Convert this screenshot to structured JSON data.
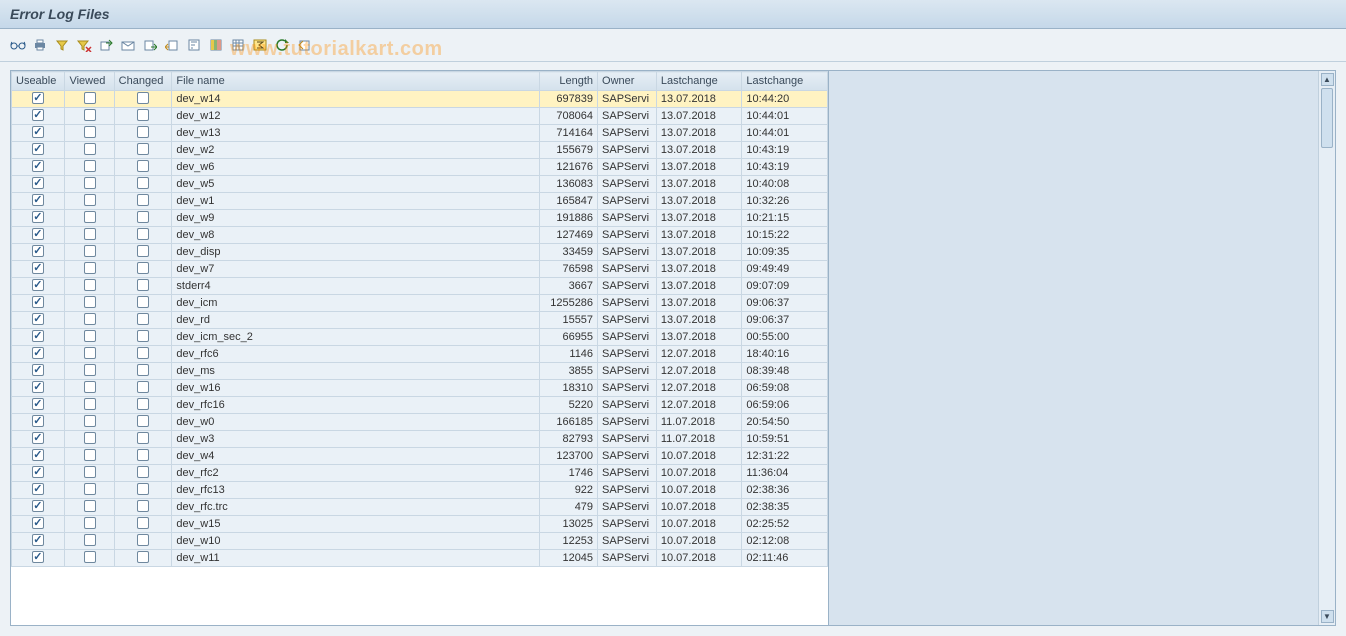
{
  "title": "Error Log Files",
  "watermark": "www.tutorialkart.com",
  "toolbar": [
    {
      "name": "glasses-icon",
      "title": "Display"
    },
    {
      "name": "print-icon",
      "title": "Print"
    },
    {
      "name": "filter-icon",
      "title": "Filter"
    },
    {
      "name": "filter-delete-icon",
      "title": "Delete Filter"
    },
    {
      "name": "export-icon",
      "title": "Export"
    },
    {
      "name": "send-icon",
      "title": "Send"
    },
    {
      "name": "download-icon",
      "title": "Local File"
    },
    {
      "name": "import-icon",
      "title": "Import"
    },
    {
      "name": "sort-asc-icon",
      "title": "Sort Ascending"
    },
    {
      "name": "layout-icon",
      "title": "Change Layout"
    },
    {
      "name": "grid-icon",
      "title": "Select Layout"
    },
    {
      "name": "sum-icon",
      "title": "Total"
    },
    {
      "name": "refresh-icon",
      "title": "Refresh"
    },
    {
      "name": "back-icon",
      "title": "Back"
    }
  ],
  "columns": {
    "useable": "Useable",
    "viewed": "Viewed",
    "changed": "Changed",
    "filename": "File name",
    "length": "Length",
    "owner": "Owner",
    "lastchange_date": "Lastchange",
    "lastchange_time": "Lastchange"
  },
  "rows": [
    {
      "useable": true,
      "viewed": false,
      "changed": false,
      "filename": "dev_w14",
      "length": "697839",
      "owner": "SAPServi",
      "date": "13.07.2018",
      "time": "10:44:20",
      "selected": true
    },
    {
      "useable": true,
      "viewed": false,
      "changed": false,
      "filename": "dev_w12",
      "length": "708064",
      "owner": "SAPServi",
      "date": "13.07.2018",
      "time": "10:44:01"
    },
    {
      "useable": true,
      "viewed": false,
      "changed": false,
      "filename": "dev_w13",
      "length": "714164",
      "owner": "SAPServi",
      "date": "13.07.2018",
      "time": "10:44:01"
    },
    {
      "useable": true,
      "viewed": false,
      "changed": false,
      "filename": "dev_w2",
      "length": "155679",
      "owner": "SAPServi",
      "date": "13.07.2018",
      "time": "10:43:19"
    },
    {
      "useable": true,
      "viewed": false,
      "changed": false,
      "filename": "dev_w6",
      "length": "121676",
      "owner": "SAPServi",
      "date": "13.07.2018",
      "time": "10:43:19"
    },
    {
      "useable": true,
      "viewed": false,
      "changed": false,
      "filename": "dev_w5",
      "length": "136083",
      "owner": "SAPServi",
      "date": "13.07.2018",
      "time": "10:40:08"
    },
    {
      "useable": true,
      "viewed": false,
      "changed": false,
      "filename": "dev_w1",
      "length": "165847",
      "owner": "SAPServi",
      "date": "13.07.2018",
      "time": "10:32:26"
    },
    {
      "useable": true,
      "viewed": false,
      "changed": false,
      "filename": "dev_w9",
      "length": "191886",
      "owner": "SAPServi",
      "date": "13.07.2018",
      "time": "10:21:15"
    },
    {
      "useable": true,
      "viewed": false,
      "changed": false,
      "filename": "dev_w8",
      "length": "127469",
      "owner": "SAPServi",
      "date": "13.07.2018",
      "time": "10:15:22"
    },
    {
      "useable": true,
      "viewed": false,
      "changed": false,
      "filename": "dev_disp",
      "length": "33459",
      "owner": "SAPServi",
      "date": "13.07.2018",
      "time": "10:09:35"
    },
    {
      "useable": true,
      "viewed": false,
      "changed": false,
      "filename": "dev_w7",
      "length": "76598",
      "owner": "SAPServi",
      "date": "13.07.2018",
      "time": "09:49:49"
    },
    {
      "useable": true,
      "viewed": false,
      "changed": false,
      "filename": "stderr4",
      "length": "3667",
      "owner": "SAPServi",
      "date": "13.07.2018",
      "time": "09:07:09"
    },
    {
      "useable": true,
      "viewed": false,
      "changed": false,
      "filename": "dev_icm",
      "length": "1255286",
      "owner": "SAPServi",
      "date": "13.07.2018",
      "time": "09:06:37"
    },
    {
      "useable": true,
      "viewed": false,
      "changed": false,
      "filename": "dev_rd",
      "length": "15557",
      "owner": "SAPServi",
      "date": "13.07.2018",
      "time": "09:06:37"
    },
    {
      "useable": true,
      "viewed": false,
      "changed": false,
      "filename": "dev_icm_sec_2",
      "length": "66955",
      "owner": "SAPServi",
      "date": "13.07.2018",
      "time": "00:55:00"
    },
    {
      "useable": true,
      "viewed": false,
      "changed": false,
      "filename": "dev_rfc6",
      "length": "1146",
      "owner": "SAPServi",
      "date": "12.07.2018",
      "time": "18:40:16"
    },
    {
      "useable": true,
      "viewed": false,
      "changed": false,
      "filename": "dev_ms",
      "length": "3855",
      "owner": "SAPServi",
      "date": "12.07.2018",
      "time": "08:39:48"
    },
    {
      "useable": true,
      "viewed": false,
      "changed": false,
      "filename": "dev_w16",
      "length": "18310",
      "owner": "SAPServi",
      "date": "12.07.2018",
      "time": "06:59:08"
    },
    {
      "useable": true,
      "viewed": false,
      "changed": false,
      "filename": "dev_rfc16",
      "length": "5220",
      "owner": "SAPServi",
      "date": "12.07.2018",
      "time": "06:59:06"
    },
    {
      "useable": true,
      "viewed": false,
      "changed": false,
      "filename": "dev_w0",
      "length": "166185",
      "owner": "SAPServi",
      "date": "11.07.2018",
      "time": "20:54:50"
    },
    {
      "useable": true,
      "viewed": false,
      "changed": false,
      "filename": "dev_w3",
      "length": "82793",
      "owner": "SAPServi",
      "date": "11.07.2018",
      "time": "10:59:51"
    },
    {
      "useable": true,
      "viewed": false,
      "changed": false,
      "filename": "dev_w4",
      "length": "123700",
      "owner": "SAPServi",
      "date": "10.07.2018",
      "time": "12:31:22"
    },
    {
      "useable": true,
      "viewed": false,
      "changed": false,
      "filename": "dev_rfc2",
      "length": "1746",
      "owner": "SAPServi",
      "date": "10.07.2018",
      "time": "11:36:04"
    },
    {
      "useable": true,
      "viewed": false,
      "changed": false,
      "filename": "dev_rfc13",
      "length": "922",
      "owner": "SAPServi",
      "date": "10.07.2018",
      "time": "02:38:36"
    },
    {
      "useable": true,
      "viewed": false,
      "changed": false,
      "filename": "dev_rfc.trc",
      "length": "479",
      "owner": "SAPServi",
      "date": "10.07.2018",
      "time": "02:38:35"
    },
    {
      "useable": true,
      "viewed": false,
      "changed": false,
      "filename": "dev_w15",
      "length": "13025",
      "owner": "SAPServi",
      "date": "10.07.2018",
      "time": "02:25:52"
    },
    {
      "useable": true,
      "viewed": false,
      "changed": false,
      "filename": "dev_w10",
      "length": "12253",
      "owner": "SAPServi",
      "date": "10.07.2018",
      "time": "02:12:08"
    },
    {
      "useable": true,
      "viewed": false,
      "changed": false,
      "filename": "dev_w11",
      "length": "12045",
      "owner": "SAPServi",
      "date": "10.07.2018",
      "time": "02:11:46"
    }
  ]
}
